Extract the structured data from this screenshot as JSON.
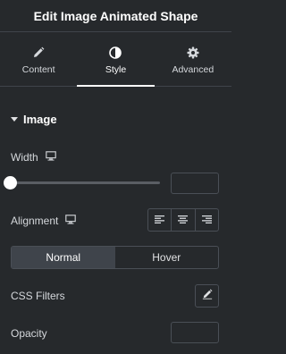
{
  "header": {
    "title": "Edit Image Animated Shape"
  },
  "tabs": [
    {
      "label": "Content",
      "icon": "pencil-icon",
      "active": false
    },
    {
      "label": "Style",
      "icon": "half-circle-icon",
      "active": true
    },
    {
      "label": "Advanced",
      "icon": "gear-icon",
      "active": false
    }
  ],
  "section": {
    "title": "Image",
    "expanded": true
  },
  "controls": {
    "width": {
      "label": "Width",
      "value": "",
      "slider_fraction": 0
    },
    "alignment": {
      "label": "Alignment",
      "options": [
        "align-left-icon",
        "align-center-icon",
        "align-right-icon"
      ]
    },
    "state_toggle": {
      "options": [
        "Normal",
        "Hover"
      ],
      "selected": "Normal"
    },
    "css_filters": {
      "label": "CSS Filters"
    },
    "opacity": {
      "label": "Opacity",
      "value": ""
    }
  },
  "colors": {
    "background": "#26292c",
    "border": "#4a4f56",
    "active_toggle": "#3f444b"
  }
}
